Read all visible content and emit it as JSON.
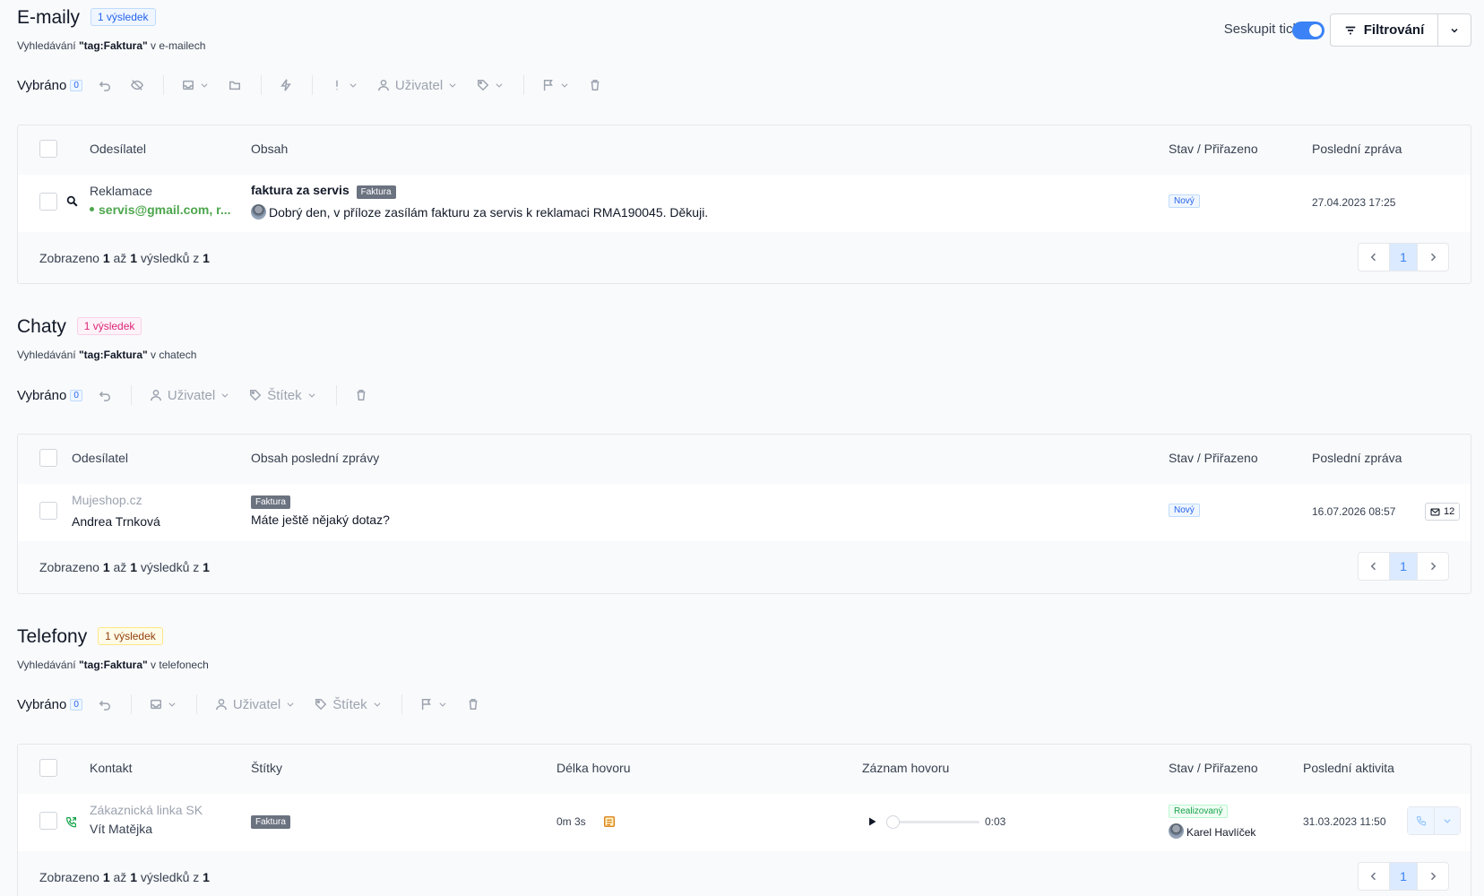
{
  "header": {
    "group_label": "Seskupit tickety",
    "filter_label": "Filtrování"
  },
  "toolbar": {
    "selected_label": "Vybráno",
    "selected_count": "0",
    "user_label": "Uživatel",
    "tag_label": "Štítek"
  },
  "emails": {
    "title": "E-maily",
    "badge": "1 výsledek",
    "sub_prefix": "Vyhledávání",
    "sub_query": "\"tag:Faktura\"",
    "sub_suffix": "v e-mailech",
    "columns": [
      "Odesílatel",
      "Obsah",
      "Stav / Přiřazeno",
      "Poslední zpráva"
    ],
    "row": {
      "sender_name": "Reklamace",
      "sender_email": "servis@gmail.com, r...",
      "subject": "faktura za servis",
      "tag": "Faktura",
      "preview": "Dobrý den, v příloze zasílám fakturu za servis k reklamaci RMA190045. Děkuji.",
      "status": "Nový",
      "date": "27.04.2023 17:25"
    },
    "footer": {
      "shown": "Zobrazeno",
      "from": "1",
      "to_word": "až",
      "to": "1",
      "of_word": "výsledků z",
      "total": "1"
    },
    "page": "1"
  },
  "chats": {
    "title": "Chaty",
    "badge": "1 výsledek",
    "sub_prefix": "Vyhledávání",
    "sub_query": "\"tag:Faktura\"",
    "sub_suffix": "v chatech",
    "columns": [
      "Odesílatel",
      "Obsah poslední zprávy",
      "Stav / Přiřazeno",
      "Poslední zpráva"
    ],
    "row": {
      "source": "Mujeshop.cz",
      "sender_name": "Andrea Trnková",
      "tag": "Faktura",
      "message": "Máte ještě nějaký dotaz?",
      "status": "Nový",
      "date": "16.07.2026 08:57",
      "msg_count": "12"
    },
    "footer": {
      "shown": "Zobrazeno",
      "from": "1",
      "to_word": "až",
      "to": "1",
      "of_word": "výsledků z",
      "total": "1"
    },
    "page": "1"
  },
  "phones": {
    "title": "Telefony",
    "badge": "1 výsledek",
    "sub_prefix": "Vyhledávání",
    "sub_query": "\"tag:Faktura\"",
    "sub_suffix": "v telefonech",
    "columns": [
      "Kontakt",
      "Štítky",
      "Délka hovoru",
      "Záznam hovoru",
      "Stav / Přiřazeno",
      "Poslední aktivita"
    ],
    "row": {
      "line": "Zákaznická linka SK",
      "contact_name": "Vít Matějka",
      "tag": "Faktura",
      "duration": "0m 3s",
      "record_time": "0:03",
      "status": "Realizovaný",
      "assignee": "Karel Havlíček",
      "date": "31.03.2023 11:50"
    },
    "footer": {
      "shown": "Zobrazeno",
      "from": "1",
      "to_word": "až",
      "to": "1",
      "of_word": "výsledků z",
      "total": "1"
    },
    "page": "1"
  },
  "colors": {
    "accent": "#3b82f6",
    "email_green": "#22a34a",
    "phone_green": "#16a34a"
  }
}
